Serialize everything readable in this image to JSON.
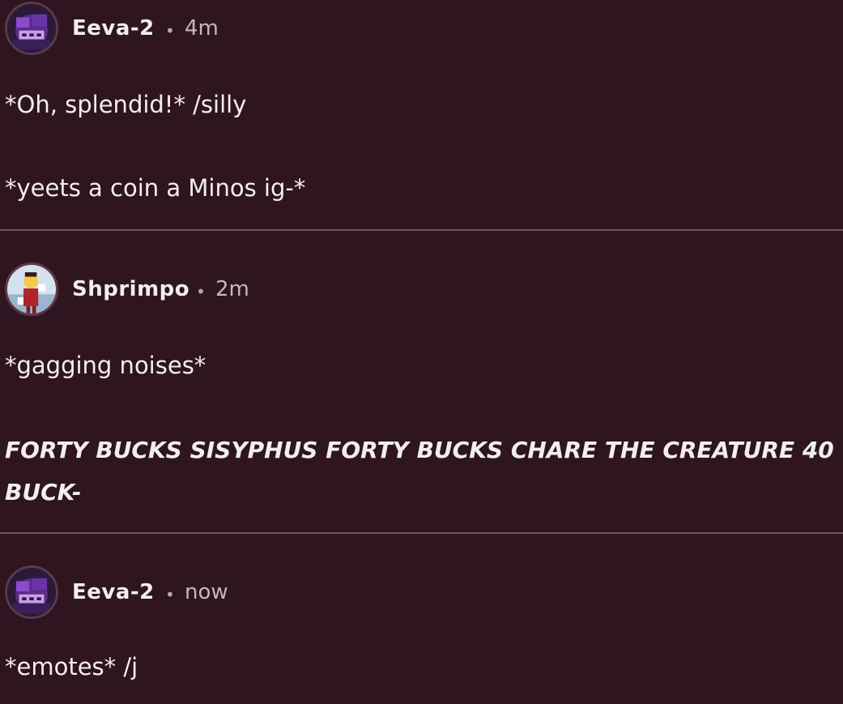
{
  "posts": [
    {
      "author": "Eeva-2",
      "separator": "•",
      "time": "4m",
      "lines": [
        "*Oh, splendid!* /silly",
        "*yeets a coin a Minos ig-*"
      ]
    },
    {
      "author": "Shprimpo",
      "separator": "•",
      "time": "2m",
      "lines": [
        "*gagging noises*",
        "FORTY BUCKS SISYPHUS FORTY BUCKS CHARE THE CREATURE 40 BUCK-"
      ]
    },
    {
      "author": "Eeva-2",
      "separator": "•",
      "time": "now",
      "lines": [
        "*emotes* /j"
      ]
    }
  ],
  "colors": {
    "background": "#2e1520",
    "divider": "#6b5560",
    "text": "#f2eef0",
    "muted": "#c4b8be"
  },
  "icons": [
    "avatar-eeva",
    "avatar-shprimpo"
  ]
}
